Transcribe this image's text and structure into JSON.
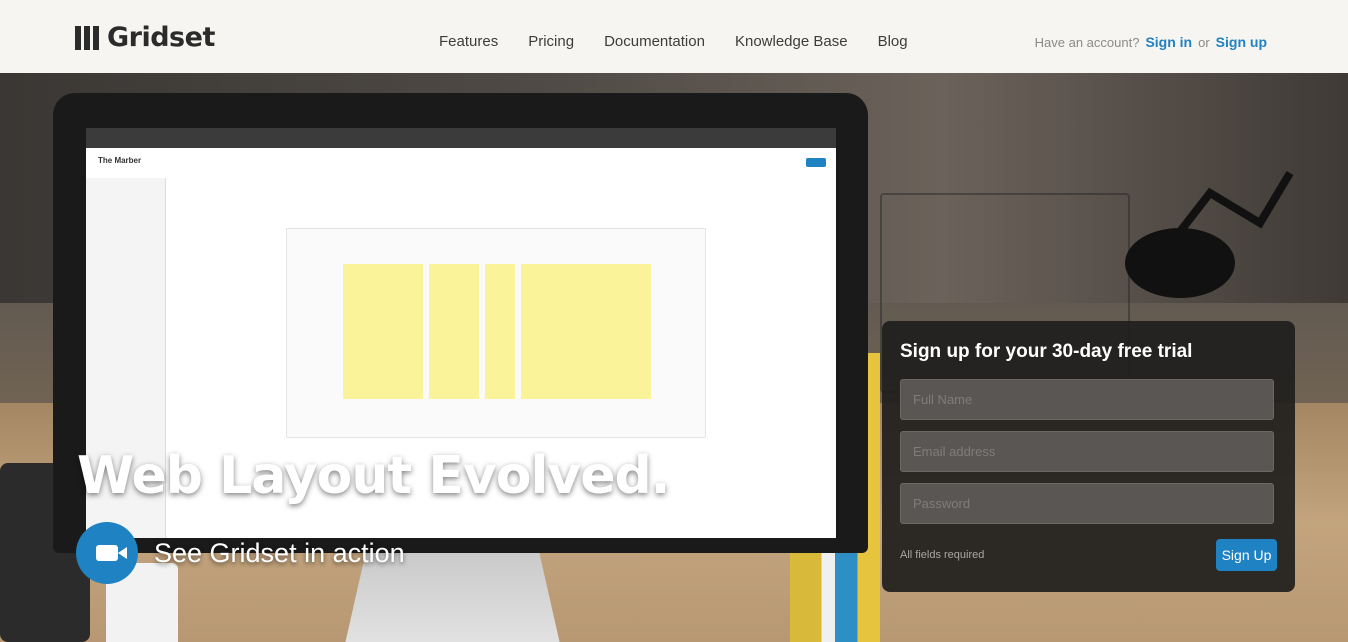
{
  "header": {
    "logo_text": "Gridset",
    "nav": [
      "Features",
      "Pricing",
      "Documentation",
      "Knowledge Base",
      "Blog"
    ],
    "account_prompt": "Have an account?",
    "sign_in": "Sign in",
    "or_text": "or",
    "sign_up": "Sign up"
  },
  "hero": {
    "title": "Web Layout Evolved.",
    "video_label": "See Gridset in action",
    "video_icon": "video-camera-icon",
    "screen_title": "The Marber"
  },
  "signup": {
    "title": "Sign up for your 30-day free trial",
    "full_name_placeholder": "Full Name",
    "email_placeholder": "Email address",
    "password_placeholder": "Password",
    "fields_required": "All fields required",
    "button": "Sign Up"
  },
  "colors": {
    "accent": "#1f82c2",
    "header_bg": "#f7f5f1",
    "panel_bg": "#201e1d"
  }
}
